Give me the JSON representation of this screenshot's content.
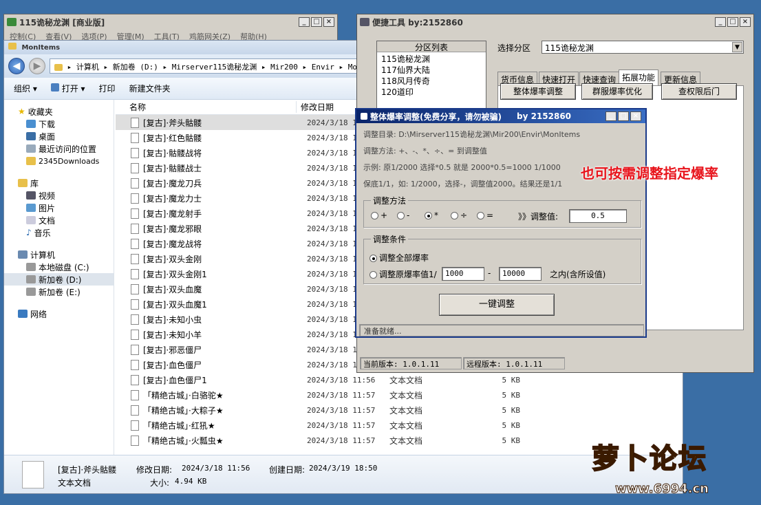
{
  "top_window": {
    "title": "115诡秘龙渊 [商业版]",
    "menu": [
      "控制(C)",
      "查看(V)",
      "选项(P)",
      "管理(M)",
      "工具(T)",
      "鸡筋网关(Z)",
      "帮助(H)"
    ]
  },
  "explorer": {
    "title": "MonItems",
    "address": [
      "计算机",
      "新加卷 (D:)",
      "Mirserver115诡秘龙渊",
      "Mir200",
      "Envir",
      "MonIt"
    ],
    "commands": [
      "组织",
      "打开",
      "打印",
      "新建文件夹"
    ],
    "nav": {
      "favorites": "收藏夹",
      "fav_items": [
        "下载",
        "桌面",
        "最近访问的位置",
        "2345Downloads"
      ],
      "libraries": "库",
      "lib_items": [
        "视频",
        "图片",
        "文档",
        "音乐"
      ],
      "computer": "计算机",
      "drives": [
        "本地磁盘 (C:)",
        "新加卷 (D:)",
        "新加卷 (E:)"
      ],
      "network": "网络"
    },
    "columns": {
      "name": "名称",
      "date": "修改日期"
    },
    "files": [
      {
        "name": "[复古]·斧头骷髅",
        "date": "2024/3/18 11",
        "type": "",
        "size": ""
      },
      {
        "name": "[复古]·红色骷髅",
        "date": "2024/3/18 11",
        "type": "",
        "size": ""
      },
      {
        "name": "[复古]·骷髅战将",
        "date": "2024/3/18 11",
        "type": "",
        "size": ""
      },
      {
        "name": "[复古]·骷髅战士",
        "date": "2024/3/18 11",
        "type": "",
        "size": ""
      },
      {
        "name": "[复古]·魔龙刀兵",
        "date": "2024/3/18 11",
        "type": "",
        "size": ""
      },
      {
        "name": "[复古]·魔龙力士",
        "date": "2024/3/18 11",
        "type": "",
        "size": ""
      },
      {
        "name": "[复古]·魔龙射手",
        "date": "2024/3/18 11",
        "type": "",
        "size": ""
      },
      {
        "name": "[复古]·魔龙邪眼",
        "date": "2024/3/18 11",
        "type": "",
        "size": ""
      },
      {
        "name": "[复古]·魔龙战将",
        "date": "2024/3/18 11",
        "type": "",
        "size": ""
      },
      {
        "name": "[复古]·双头金刚",
        "date": "2024/3/18 11",
        "type": "",
        "size": ""
      },
      {
        "name": "[复古]·双头金刚1",
        "date": "2024/3/18 11",
        "type": "",
        "size": ""
      },
      {
        "name": "[复古]·双头血魔",
        "date": "2024/3/18 11",
        "type": "",
        "size": ""
      },
      {
        "name": "[复古]·双头血魔1",
        "date": "2024/3/18 11",
        "type": "",
        "size": ""
      },
      {
        "name": "[复古]·未知小虫",
        "date": "2024/3/18 11",
        "type": "",
        "size": ""
      },
      {
        "name": "[复古]·未知小羊",
        "date": "2024/3/18 11",
        "type": "",
        "size": ""
      },
      {
        "name": "[复古]·邪恶僵尸",
        "date": "2024/3/18 11",
        "type": "",
        "size": ""
      },
      {
        "name": "[复古]·血色僵尸",
        "date": "2024/3/18 11",
        "type": "",
        "size": ""
      },
      {
        "name": "[复古]·血色僵尸1",
        "date": "2024/3/18 11:56",
        "type": "文本文档",
        "size": "5 KB"
      },
      {
        "name": "「精绝古城」·白骆驼★",
        "date": "2024/3/18 11:57",
        "type": "文本文档",
        "size": "5 KB"
      },
      {
        "name": "「精绝古城」·大粽子★",
        "date": "2024/3/18 11:57",
        "type": "文本文档",
        "size": "5 KB"
      },
      {
        "name": "「精绝古城」·红犼★",
        "date": "2024/3/18 11:57",
        "type": "文本文档",
        "size": "5 KB"
      },
      {
        "name": "「精绝古城」·火瓢虫★",
        "date": "2024/3/18 11:57",
        "type": "文本文档",
        "size": "5 KB"
      }
    ],
    "details": {
      "name": "[复古]·斧头骷髅",
      "modified_label": "修改日期:",
      "modified": "2024/3/18 11:56",
      "created_label": "创建日期:",
      "created": "2024/3/19 18:50",
      "type": "文本文档",
      "size_label": "大小:",
      "size": "4.94 KB"
    }
  },
  "tool": {
    "title": "便捷工具  by:2152860",
    "partition_header": "分区列表",
    "partitions": [
      "115诡秘龙渊",
      "117仙界大陆",
      "118风月传奇",
      "120道印"
    ],
    "select_label": "选择分区",
    "select_value": "115诡秘龙渊",
    "tabs": [
      "货币信息",
      "快速打开",
      "快速查询",
      "拓展功能",
      "更新信息"
    ],
    "buttons": [
      "整体爆率调整",
      "群服爆率优化",
      "查权限后门"
    ],
    "current_version": "当前版本: 1.0.1.11",
    "remote_version": "远程版本: 1.0.1.11"
  },
  "dialog": {
    "title": "整体爆率调整(免费分享，请勿被骗)",
    "title_by": "by 2152860",
    "dir": "调整目录: D:\\Mirserver115诡秘龙渊\\Mir200\\Envir\\MonItems",
    "method": "调整方法: +、-、*、÷、=  到调整值",
    "example": "示例: 原1/2000 选择*0.5 就是 2000*0.5=1000  1/1000",
    "note": "保底1/1，如: 1/2000，选择-，调整值2000。结果还是1/1",
    "method_group": "调整方法",
    "ops": [
      "+",
      "-",
      "*",
      "÷",
      "="
    ],
    "value_label": "》》调整值:",
    "value": "0.5",
    "cond_group": "调整条件",
    "cond_all": "调整全部爆率",
    "cond_range": "调整原爆率值1/",
    "range_from": "1000",
    "range_dash": "-",
    "range_to": "10000",
    "range_suffix": "之内(含所设值)",
    "run": "一键调整",
    "status": "准备就绪..."
  },
  "annotation": "也可按需调整指定爆率",
  "logo": {
    "text": "萝卜论坛",
    "url": "www.6994.cn"
  }
}
